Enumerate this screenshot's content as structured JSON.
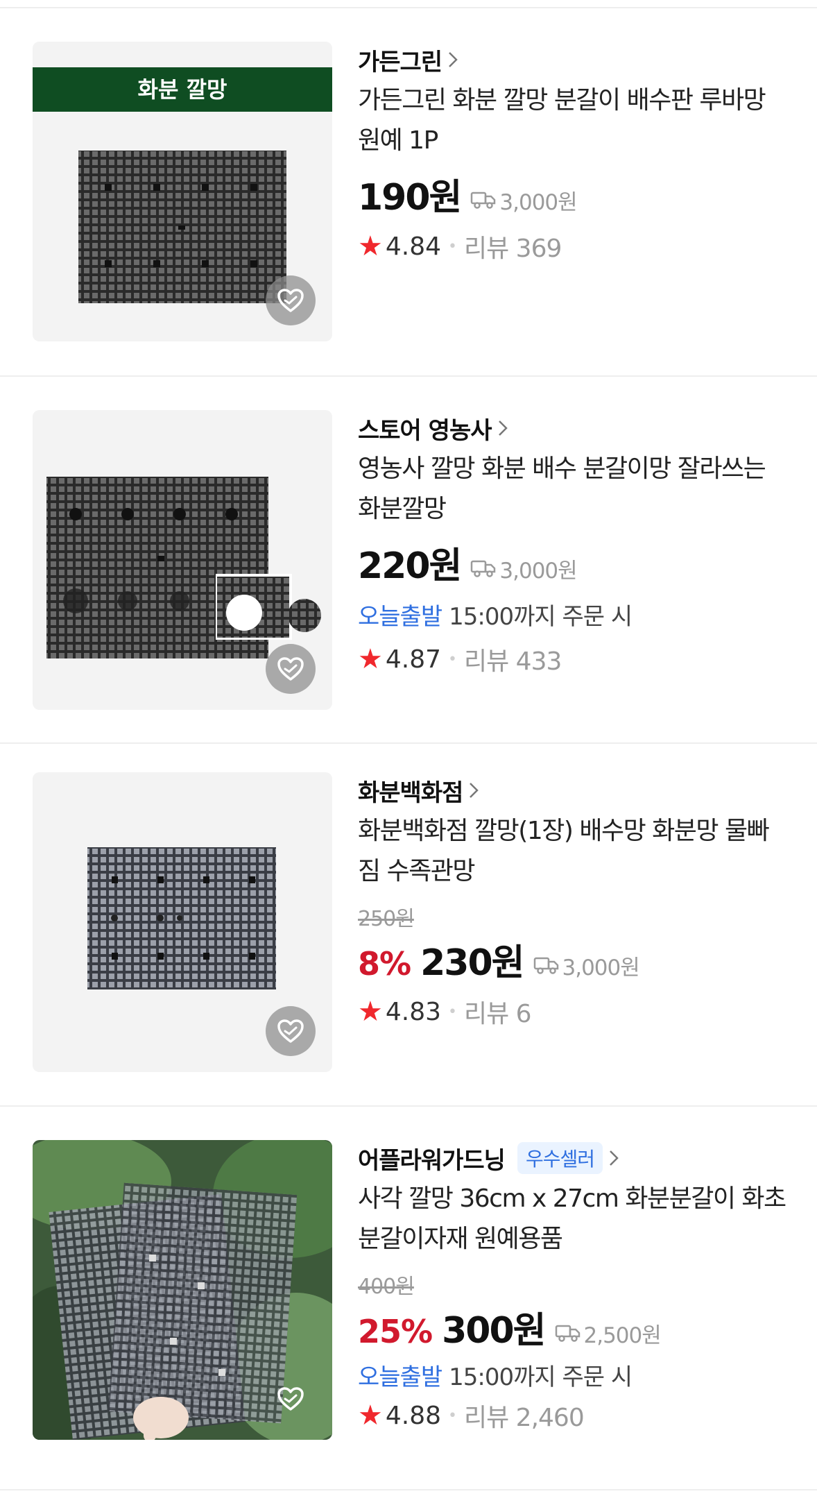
{
  "products": [
    {
      "store": "가든그린",
      "title": "가든그린 화분 깔망 분갈이 배수판 루바망 원예 1P",
      "image_banner": "화분 깔망",
      "price": "190원",
      "shipping": "3,000원",
      "rating": "4.84",
      "review": "리뷰 369"
    },
    {
      "store": "스토어 영농사",
      "title": "영농사 깔망 화분 배수 분갈이망 잘라쓰는 화분깔망",
      "price": "220원",
      "shipping": "3,000원",
      "delivery_badge": "오늘출발",
      "delivery_text": "15:00까지 주문 시",
      "rating": "4.87",
      "review": "리뷰 433"
    },
    {
      "store": "화분백화점",
      "title": "화분백화점 깔망(1장) 배수망 화분망 물빠짐 수족관망",
      "original_price": "250원",
      "discount": "8%",
      "price": "230원",
      "shipping": "3,000원",
      "rating": "4.83",
      "review": "리뷰 6"
    },
    {
      "store": "어플라워가드닝",
      "seller_badge": "우수셀러",
      "title": "사각 깔망 36cm x 27cm 화분분갈이 화초 분갈이자재 원예용품",
      "original_price": "400원",
      "discount": "25%",
      "price": "300원",
      "shipping": "2,500원",
      "delivery_badge": "오늘출발",
      "delivery_text": "15:00까지 주문 시",
      "rating": "4.88",
      "review": "리뷰 2,460"
    }
  ],
  "icons": {
    "star": "★",
    "dot": "•"
  },
  "colors": {
    "star": "#f0282d",
    "discount": "#d1192d",
    "delivery_badge": "#2f6fe0",
    "muted": "#9a9a9a"
  }
}
